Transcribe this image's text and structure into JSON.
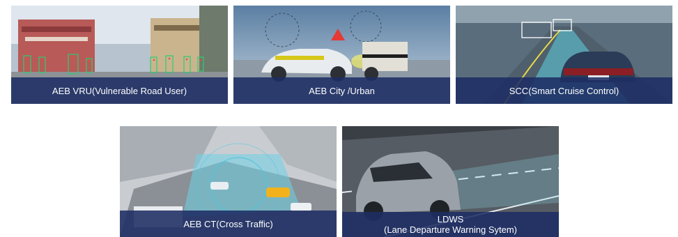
{
  "tiles": [
    {
      "caption": "AEB VRU(Vulnerable Road User)",
      "scene": "street-pedestrian-detection"
    },
    {
      "caption": "AEB City /Urban",
      "scene": "car-target-crash-test"
    },
    {
      "caption": "SCC(Smart Cruise Control)",
      "scene": "highway-radar-following"
    },
    {
      "caption": "AEB CT(Cross Traffic)",
      "scene": "intersection-sensor-view"
    },
    {
      "caption_line1": "LDWS",
      "caption_line2": "(Lane Departure Warning Sytem)",
      "scene": "suv-lane-departure"
    }
  ]
}
